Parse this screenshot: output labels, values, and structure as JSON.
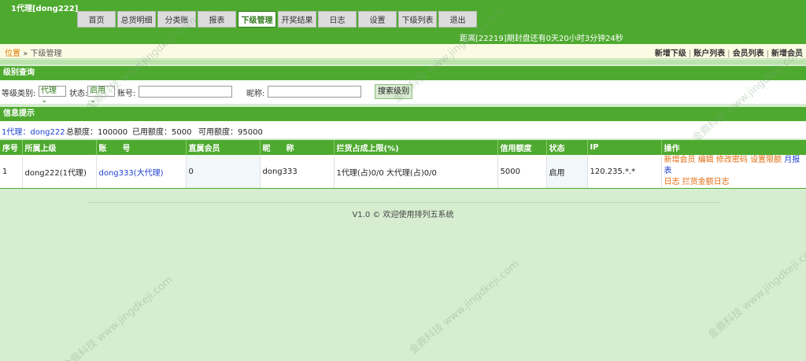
{
  "header": {
    "user": "1代理[dong222]",
    "countdown": "距离[22219]期封盘还有0天20小时3分钟24秒"
  },
  "nav": [
    "首页",
    "总货明细",
    "分类账",
    "报表",
    "下级管理",
    "开奖结果",
    "日志",
    "设置",
    "下级列表",
    "退出"
  ],
  "location": {
    "prefix": "位置",
    "separator": "»",
    "current": "下级管理"
  },
  "quick_links": [
    "新增下级",
    "账户列表",
    "会员列表",
    "新增会员"
  ],
  "search": {
    "title": "级别查询",
    "level_label": "等级类别:",
    "level_value": "代理",
    "status_label": "状态:",
    "status_value": "启用",
    "account_label": "账号:",
    "nickname_label": "昵称:",
    "search_button": "搜索级别"
  },
  "info": {
    "title": "信息提示",
    "who": "1代理：dong222",
    "total": "总额度：100000",
    "used": "已用额度：5000",
    "available": "可用额度：95000"
  },
  "table": {
    "headers": [
      "序号",
      "所属上级",
      "账　　号",
      "直属会员",
      "昵　　称",
      "拦货占成上限(%)",
      "信用额度",
      "状态",
      "IP",
      "操作"
    ],
    "rows": [
      {
        "no": "1",
        "parent": "dong222(1代理)",
        "account": "dong333(大代理)",
        "members": "0",
        "nickname": "dong333",
        "limit": "1代理(占)0/0 大代理(占)0/0",
        "credit": "5000",
        "status": "启用",
        "ip": "120.235.*.*",
        "ops": [
          "新增会员",
          "编辑",
          "修改密码",
          "设置限额",
          "月报表",
          "日志",
          "拦货金额日志"
        ]
      }
    ]
  },
  "footer": "V1.0 © 欢迎使用排列五系统",
  "watermark": "金鼎科技 www.jingdkeji.com",
  "colors": {
    "header_green": "#4eaa2f",
    "body_bg": "#d6edd0",
    "link_orange": "#e26b10",
    "link_blue": "#1d3fd1"
  }
}
